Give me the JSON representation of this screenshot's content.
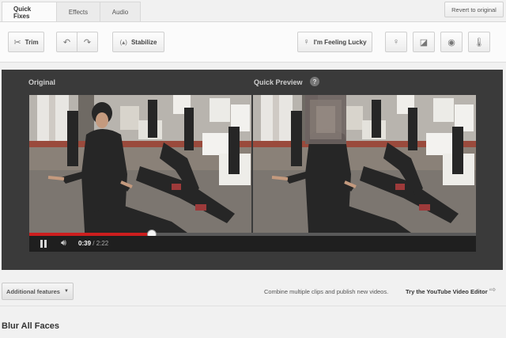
{
  "tabs": [
    {
      "label": "Quick Fixes",
      "active": true
    },
    {
      "label": "Effects",
      "active": false
    },
    {
      "label": "Audio",
      "active": false
    }
  ],
  "revert_label": "Revert to original",
  "toolbar": {
    "trim_label": "Trim",
    "stabilize_label": "Stabilize",
    "lucky_label": "I'm Feeling Lucky",
    "icons": {
      "trim": "scissors-icon",
      "undo": "rotate-left-icon",
      "redo": "rotate-right-icon",
      "stabilize": "stabilize-icon",
      "lucky": "lightbulb-icon",
      "brightness": "lightbulb-icon",
      "contrast": "contrast-icon",
      "color": "color-icon",
      "temperature": "thermometer-icon"
    }
  },
  "preview": {
    "original_label": "Original",
    "quick_preview_label": "Quick Preview",
    "help": "?"
  },
  "player": {
    "current_time": "0:39",
    "separator": " / ",
    "duration": "2:22",
    "progress": 0.2746,
    "progress_color": "#cc1e1e"
  },
  "bottom": {
    "additional_features": "Additional features",
    "combine_text": "Combine multiple clips and publish new videos.",
    "try_editor": "Try the YouTube Video Editor",
    "section_title": "Blur All Faces"
  }
}
